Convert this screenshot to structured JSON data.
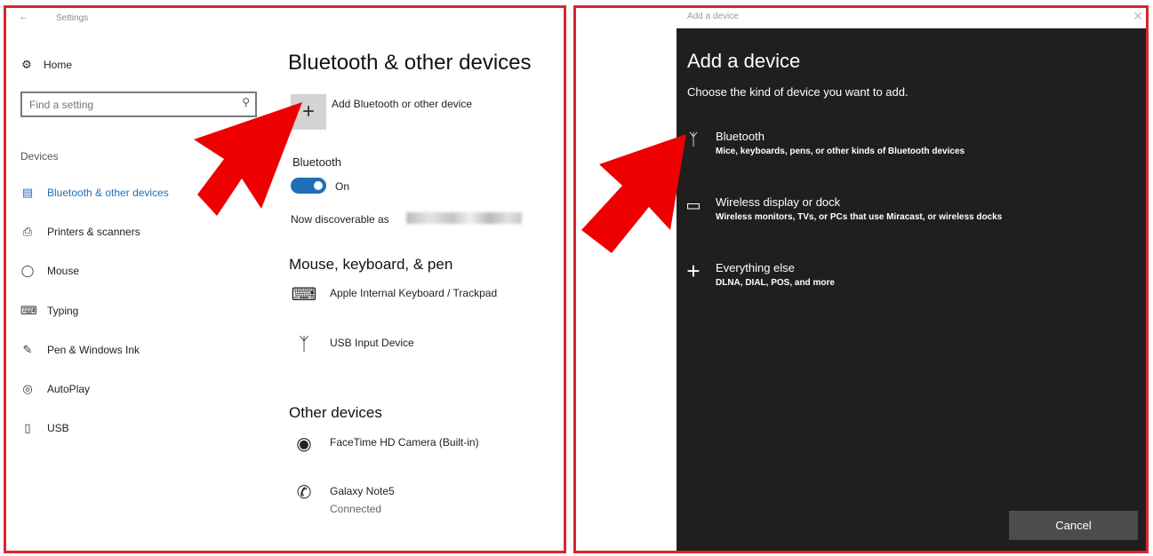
{
  "settings": {
    "window_title": "Settings",
    "home_label": "Home",
    "search_placeholder": "Find a setting",
    "section_label": "Devices",
    "nav_items": [
      {
        "label": "Bluetooth & other devices",
        "icon": "bluetooth-devices-icon"
      },
      {
        "label": "Printers & scanners",
        "icon": "printer-icon"
      },
      {
        "label": "Mouse",
        "icon": "mouse-icon"
      },
      {
        "label": "Typing",
        "icon": "keyboard-icon"
      },
      {
        "label": "Pen & Windows Ink",
        "icon": "pen-icon"
      },
      {
        "label": "AutoPlay",
        "icon": "autoplay-icon"
      },
      {
        "label": "USB",
        "icon": "usb-icon"
      }
    ],
    "main": {
      "title": "Bluetooth & other devices",
      "add_device_label": "Add Bluetooth or other device",
      "bluetooth_title": "Bluetooth",
      "toggle_state": "On",
      "discoverable_label": "Now discoverable as",
      "mouse_section_title": "Mouse, keyboard, & pen",
      "mouse_devices": [
        {
          "name": "Apple Internal Keyboard / Trackpad",
          "icon": "keyboard-icon"
        },
        {
          "name": "USB Input Device",
          "icon": "bluetooth-icon"
        }
      ],
      "other_section_title": "Other devices",
      "other_devices": [
        {
          "name": "FaceTime HD Camera (Built-in)",
          "icon": "webcam-icon",
          "status": ""
        },
        {
          "name": "Galaxy Note5",
          "icon": "phone-icon",
          "status": "Connected"
        }
      ]
    }
  },
  "dialog": {
    "bar_title": "Add a device",
    "title": "Add a device",
    "subtitle": "Choose the kind of device you want to add.",
    "options": [
      {
        "name": "Bluetooth",
        "desc": "Mice, keyboards, pens, or other kinds of Bluetooth devices",
        "icon": "bluetooth-icon"
      },
      {
        "name": "Wireless display or dock",
        "desc": "Wireless monitors, TVs, or PCs that use Miracast, or wireless docks",
        "icon": "monitor-icon"
      },
      {
        "name": "Everything else",
        "desc": "DLNA, DIAL, POS, and more",
        "icon": "plus-icon"
      }
    ],
    "cancel_label": "Cancel"
  },
  "colors": {
    "highlight_border": "#d9252f",
    "arrow": "#ee0000",
    "accent": "#1f6fb8",
    "dialog_bg": "#1f1f1f"
  }
}
